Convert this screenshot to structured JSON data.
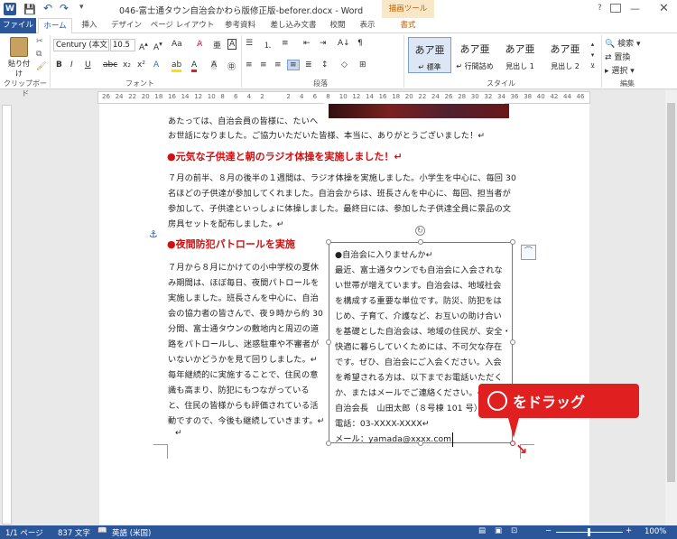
{
  "window": {
    "title": "046-富士通タウン自治会かわら版修正版-beforer.docx - Word",
    "drawing_tools": "描画ツール",
    "help": "?"
  },
  "tabs": [
    "ファイル",
    "ホーム",
    "挿入",
    "デザイン",
    "ページ レイアウト",
    "参考資料",
    "差し込み文書",
    "校閲",
    "表示",
    "書式"
  ],
  "ribbon": {
    "paste": "貼り付け",
    "font_name": "Century (本文",
    "font_size": "10.5",
    "styles": [
      {
        "preview": "あア亜",
        "name": "↵ 標準"
      },
      {
        "preview": "あア亜",
        "name": "↵ 行間詰め"
      },
      {
        "preview": "あア亜",
        "name": "見出し 1"
      },
      {
        "preview": "あア亜",
        "name": "見出し 2"
      }
    ],
    "edit_items": [
      "検索",
      "置換",
      "選択"
    ],
    "groups": [
      "クリップボード",
      "フォント",
      "段落",
      "スタイル",
      "編集"
    ]
  },
  "ruler_ticks": [
    "26",
    "24",
    "22",
    "20",
    "18",
    "16",
    "14",
    "12",
    "10",
    "8",
    "6",
    "4",
    "2",
    "",
    "2",
    "4",
    "6",
    "8",
    "10",
    "12",
    "14",
    "16",
    "18",
    "20",
    "22",
    "24",
    "26",
    "28",
    "30",
    "32",
    "34",
    "36",
    "38",
    "40",
    "42",
    "44",
    "46"
  ],
  "document": {
    "intro": [
      "あたっては、自治会員の皆様に、たいへ",
      "お世話になりました。ご協力いただいた皆様、本当に、ありがとうございました！↵"
    ],
    "h1": "●元気な子供達と朝のラジオ体操を実施しました！↵",
    "p1": [
      "７月の前半、８月の後半の１週間は、ラジオ体操を実施しました。小学生を中心に、毎回 30",
      "名ほどの子供達が参加してくれました。自治会からは、班長さんを中心に、毎回、担当者が",
      "参加して、子供達といっしょに体操しました。最終日には、参加した子供達全員に景品の文",
      "房具セットを配布しました。↵"
    ],
    "h2": "●夜間防犯パトロールを実施",
    "p2": [
      "７月から８月にかけての小中学校の夏休",
      "み期間は、ほぼ毎日、夜間パトロールを",
      "実施しました。班長さんを中心に、自治",
      "会の協力者の皆さんで、夜９時から約 30",
      "分間、富士通タウンの敷地内と周辺の道",
      "路をパトロールし、迷惑駐車や不審者が",
      "いないかどうかを見て回りしました。↵",
      "毎年継続的に実施することで、住民の意",
      "識も高まり、防犯にもつながっている",
      "と、住民の皆様からも評価されている活",
      "動ですので、今後も継続していきます。↵"
    ],
    "end": "↵"
  },
  "textbox": [
    "●自治会に入りませんか↵",
    "最近、富士通タウンでも自治会に入会されな",
    "い世帯が増えています。自治会は、地域社会",
    "を構成する重要な単位です。防災、防犯をは",
    "じめ、子育て、介護など、お互いの助け合い",
    "を基礎とした自治会は、地域の住民が、安全・",
    "快適に暮らしていくためには、不可欠な存在",
    "です。ぜひ、自治会にご入会ください。入会",
    "を希望される方は、以下までお電話いただく",
    "か、またはメールでご連絡ください。↵",
    "自治会長　山田太郎（８号棟 101 号）↵",
    "電話：03-XXXX-XXXX↵",
    "メール：yamada@xxxx.com"
  ],
  "callout": {
    "text": "をドラッグ"
  },
  "status": {
    "page": "1/1 ページ",
    "words": "837 文字",
    "lang": "英語 (米国)",
    "zoom": "100%"
  }
}
